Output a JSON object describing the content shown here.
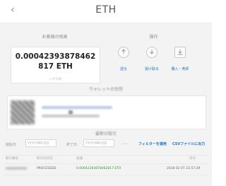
{
  "header": {
    "back_icon": "‹",
    "title": "ETH"
  },
  "balance": {
    "label": "お客様の残高",
    "value": "0.00042393878462817 ETH"
  },
  "actions": {
    "label": "操作",
    "items": [
      {
        "icon": "upload-icon",
        "label": "送る"
      },
      {
        "icon": "download-icon",
        "label": "受け取る"
      },
      {
        "icon": "buy-sell-icon",
        "label": "購入・売却"
      }
    ]
  },
  "wallet": {
    "label": "ウォレットの住所"
  },
  "history": {
    "label": "最新の取引",
    "filter": {
      "from_label": "開始日",
      "from_placeholder": "YYYY-MM-DD",
      "to_label": "終了日",
      "to_placeholder": "YYYY-MM-DD",
      "apply_button": "フィルターを適用",
      "csv_button": "CSVファイルに出力"
    },
    "columns": [
      "取引番号",
      "取引の状況",
      "金額",
      "日付"
    ],
    "rows": [
      {
        "id": "",
        "status": "PROCESSED",
        "amount": "0.00042393878462817 ETH",
        "date": "2018 02 07 23:57:29"
      }
    ]
  }
}
